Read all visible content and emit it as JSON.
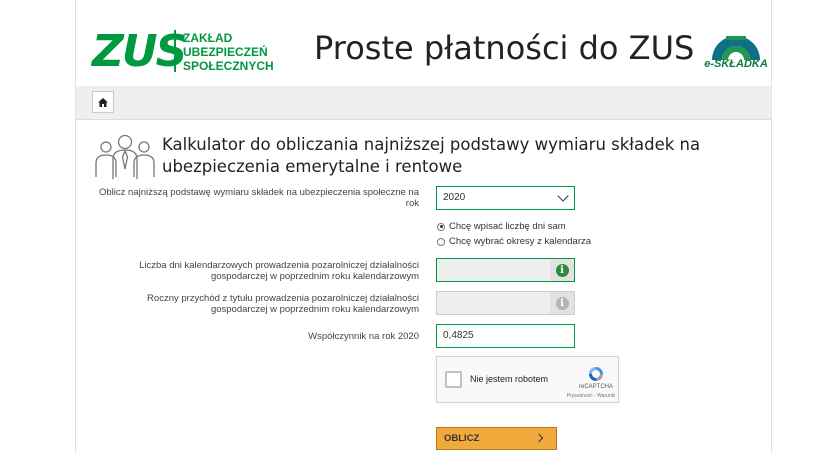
{
  "header": {
    "logo_text": "ZUS",
    "logo_sub_1": "ZAKŁAD",
    "logo_sub_2": "UBEZPIECZEŃ",
    "logo_sub_3": "SPOŁECZNYCH",
    "title": "Proste płatności do ZUS",
    "eskladka_text": "e-SKŁADKA"
  },
  "colors": {
    "brand_green": "#00993f",
    "button_orange": "#f2a93b"
  },
  "nav": {
    "home_icon": "home-icon"
  },
  "calculator": {
    "title_line1": "Kalkulator do obliczania najniższej podstawy wymiaru składek na",
    "title_line2": "ubezpieczenia emerytalne i rentowe",
    "year_label_1": "Oblicz najniższą podstawę wymiaru składek na ubezpieczenia społeczne na",
    "year_label_2": "rok",
    "year_value": "2020",
    "radio_1": "Chcę wpisać liczbę dni sam",
    "radio_2": "Chcę wybrać okresy z kalendarza",
    "days_label_1": "Liczba dni kalendarzowych prowadzenia pozarolniczej działalności",
    "days_label_2": "gospodarczej w poprzednim roku kalendarzowym",
    "days_value": "",
    "income_label_1": "Roczny przychód z tytułu prowadzenia pozarolniczej działalności",
    "income_label_2": "gospodarczej w poprzednim roku kalendarzowym",
    "income_value": "",
    "coef_label": "Współczynnik na rok 2020",
    "coef_value": "0,4825",
    "recaptcha_label": "Nie jestem robotem",
    "recaptcha_brand": "reCAPTCHA",
    "recaptcha_links": "Prywatność - Warunki",
    "submit_label": "OBLICZ"
  }
}
